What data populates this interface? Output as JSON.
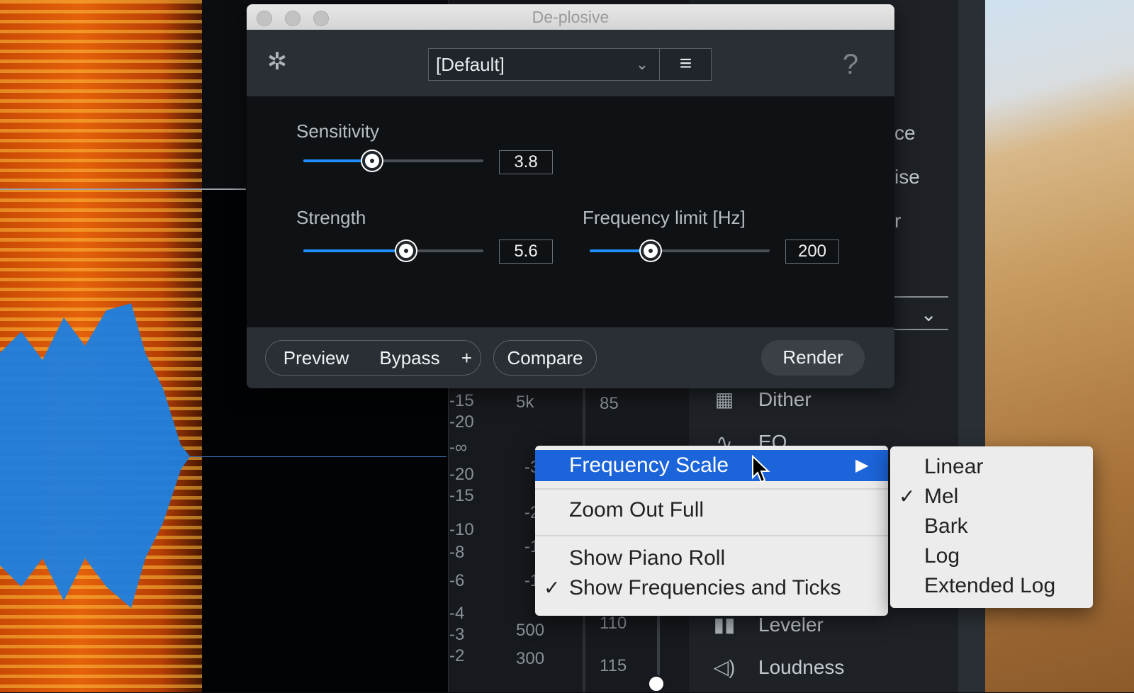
{
  "dialog": {
    "title": "De-plosive",
    "preset": "[Default]",
    "help": "?",
    "sensitivity": {
      "label": "Sensitivity",
      "value": "3.8",
      "fraction": 0.38
    },
    "strength": {
      "label": "Strength",
      "value": "5.6",
      "fraction": 0.57
    },
    "frequency_limit": {
      "label": "Frequency limit [Hz]",
      "value": "200",
      "fraction": 0.34
    },
    "buttons": {
      "preview": "Preview",
      "bypass": "Bypass",
      "plus": "+",
      "compare": "Compare",
      "render": "Render"
    }
  },
  "meter": {
    "db_ticks": [
      "-15",
      "-20",
      "-∞",
      "-20",
      "-15",
      "-10",
      "-8",
      "-6",
      "-4",
      "-3",
      "-2"
    ],
    "freq_ticks": [
      "5k",
      "-3",
      "-2",
      "-1",
      "-1",
      "500",
      "300"
    ],
    "right_ticks": [
      "85",
      "110",
      "115"
    ]
  },
  "modules": {
    "partial_labels": [
      "ce",
      "ise",
      "r"
    ],
    "items": [
      {
        "label": "Dither",
        "icon": "dither-icon"
      },
      {
        "label": "EQ",
        "icon": "eq-icon"
      },
      {
        "label": "Leveler",
        "icon": "leveler-icon"
      },
      {
        "label": "Loudness",
        "icon": "loudness-icon"
      }
    ]
  },
  "context_menu": {
    "items": [
      {
        "label": "Frequency Scale",
        "has_submenu": true,
        "highlighted": true
      },
      {
        "label": "Zoom Out Full"
      },
      {
        "label": "Show Piano Roll"
      },
      {
        "label": "Show Frequencies and Ticks",
        "checked": true
      }
    ],
    "submenu": [
      {
        "label": "Linear"
      },
      {
        "label": "Mel",
        "checked": true
      },
      {
        "label": "Bark"
      },
      {
        "label": "Log"
      },
      {
        "label": "Extended Log"
      }
    ],
    "check_mark": "✓",
    "submenu_arrow": "▶"
  },
  "colors": {
    "accent": "#1f8fff",
    "menu_highlight": "#1c64d9"
  }
}
